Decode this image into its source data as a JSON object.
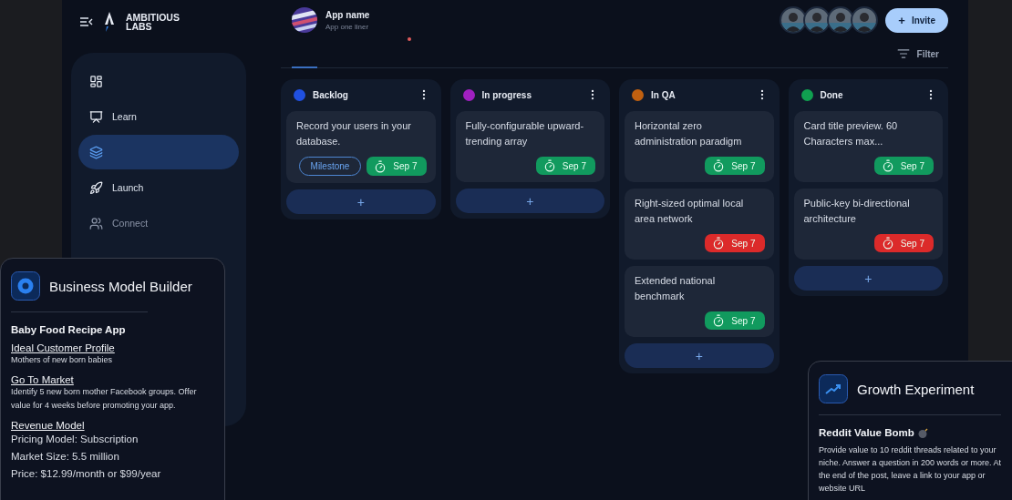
{
  "brand": {
    "name": "AMBITIOUS LABS"
  },
  "app": {
    "name": "App name",
    "tagline": "App one liner"
  },
  "invite_button": {
    "icon": "+",
    "label": "Invite"
  },
  "filter": {
    "label": "Filter"
  },
  "sidebar": {
    "items": [
      {
        "kind": "dashboard",
        "selected": false,
        "disabled": false
      },
      {
        "kind": "learn",
        "label": "Learn",
        "selected": false,
        "disabled": false
      },
      {
        "kind": "layers",
        "selected": true,
        "disabled": false
      },
      {
        "kind": "launch",
        "label": "Launch",
        "selected": false,
        "disabled": false
      },
      {
        "kind": "connect",
        "label": "Connect",
        "selected": false,
        "disabled": true
      }
    ]
  },
  "board": {
    "columns": [
      {
        "title": "Backlog",
        "color": "#2050e0",
        "add": "+",
        "cards": [
          {
            "text": "Record your users in your database.",
            "tag": "Milestone",
            "date": "Sep 7",
            "overdue": false
          }
        ]
      },
      {
        "title": "In progress",
        "color": "#a020c0",
        "add": "+",
        "cards": [
          {
            "text": "Fully-configurable upward-trending array",
            "date": "Sep 7",
            "overdue": false
          }
        ]
      },
      {
        "title": "In QA",
        "color": "#c06010",
        "add": "+",
        "cards": [
          {
            "text": "Horizontal zero administration paradigm",
            "date": "Sep 7",
            "overdue": false
          },
          {
            "text": "Right-sized optimal local area network",
            "date": "Sep 7",
            "overdue": true
          },
          {
            "text": "Extended national benchmark",
            "date": "Sep 7",
            "overdue": false
          }
        ]
      },
      {
        "title": "Done",
        "color": "#10a050",
        "add": "+",
        "cards": [
          {
            "text": "Card title preview.  60 Characters max...",
            "date": "Sep 7",
            "overdue": false
          },
          {
            "text": "Public-key bi-directional architecture",
            "date": "Sep 7",
            "overdue": true
          }
        ]
      }
    ]
  },
  "business_card": {
    "title": "Business Model Builder",
    "subtitle": "Baby Food Recipe App",
    "sections": [
      {
        "heading": "Ideal Customer Profile",
        "kind": "note",
        "lines": [
          "Mothers of new born babies"
        ]
      },
      {
        "heading": "Go To Market",
        "kind": "note",
        "lines": [
          "Identify 5 new born mother Facebook groups. Offer value for 4 weeks before promoting your app."
        ]
      },
      {
        "heading": "Revenue Model",
        "kind": "detail",
        "lines": [
          "Pricing Model: Subscription",
          "Market Size: 5.5 million",
          "Price: $12.99/month or $99/year"
        ]
      }
    ]
  },
  "growth_card": {
    "title": "Growth Experiment",
    "subtitle": "Reddit Value Bomb",
    "body": "Provide value to 10 reddit threads related to your niche. Answer a question in 200 words or more. At the end of the post, leave a link to your app or website URL"
  }
}
